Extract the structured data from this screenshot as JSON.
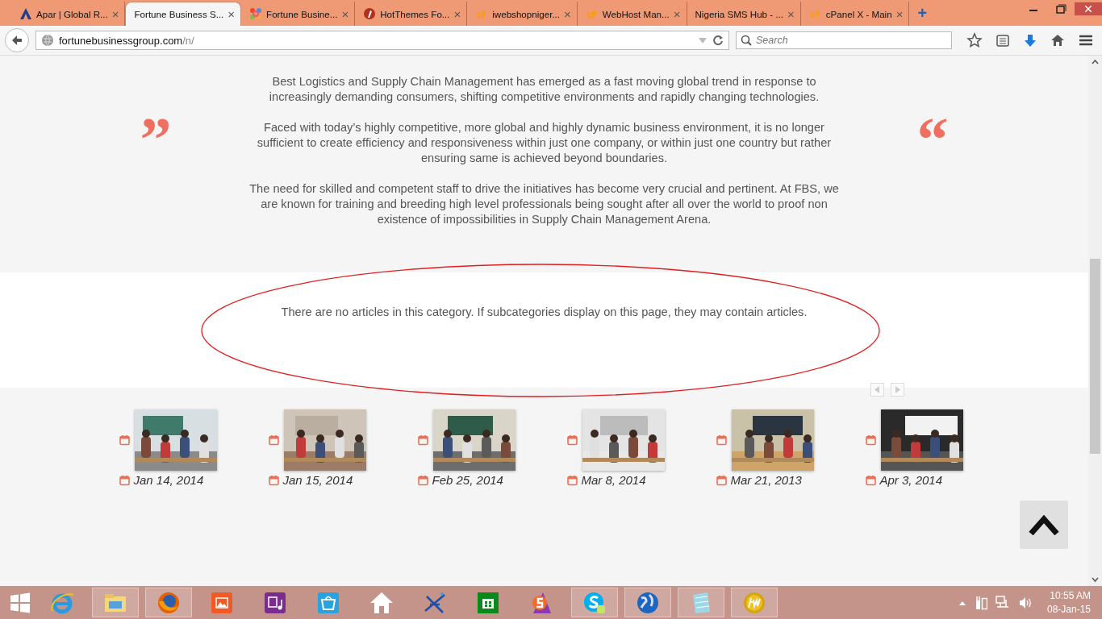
{
  "browser": {
    "tabs": [
      {
        "title": "Apar | Global R...",
        "selected": false
      },
      {
        "title": "Fortune Business S...",
        "selected": true
      },
      {
        "title": "Fortune Busine...",
        "selected": false
      },
      {
        "title": "HotThemes Fo...",
        "selected": false
      },
      {
        "title": "iwebshopniger...",
        "selected": false
      },
      {
        "title": "WebHost Man...",
        "selected": false
      },
      {
        "title": "Nigeria SMS Hub - ...",
        "selected": false
      },
      {
        "title": "cPanel X - Main",
        "selected": false
      }
    ],
    "close_glyph": "×",
    "new_tab": "+",
    "address": {
      "host": "fortunebusinessgroup.com",
      "path": "/n/"
    },
    "search": {
      "placeholder": "Search"
    }
  },
  "page": {
    "quote_open": "”",
    "quote_close": "“",
    "paragraphs": [
      "Best Logistics and Supply Chain Management has emerged as a fast moving global trend in response to increasingly demanding consumers, shifting competitive environments and rapidly changing technologies.",
      "Faced with today’s highly competitive, more global and highly dynamic business environment, it is no longer sufficient to create efficiency and responsiveness within just one company, or within just one country but rather ensuring same is achieved beyond boundaries.",
      "The need for skilled and competent staff to drive the initiatives has become very crucial and pertinent. At FBS, we are known for training and breeding high level professionals being sought after all over the world to proof non existence of impossibilities in Supply Chain Management Arena."
    ],
    "notice": "There are no articles in this category. If subcategories display on this page, they may contain articles.",
    "gallery": [
      {
        "date": "Jan 14, 2014",
        "kind": "picture"
      },
      {
        "date": "Jan 15, 2014",
        "kind": "picture"
      },
      {
        "date": "Feb 25, 2014",
        "kind": "picture"
      },
      {
        "date": "Mar 8, 2014",
        "kind": "picture"
      },
      {
        "date": "Mar 21, 2013",
        "kind": "picture"
      },
      {
        "date": "Apr 3, 2014",
        "kind": "picture"
      }
    ]
  },
  "taskbar": {
    "apps": [
      {
        "open": false
      },
      {
        "open": true
      },
      {
        "open": true
      },
      {
        "open": false
      },
      {
        "open": false
      },
      {
        "open": false
      },
      {
        "open": false
      },
      {
        "open": false
      },
      {
        "open": false
      },
      {
        "open": false
      },
      {
        "open": true
      },
      {
        "open": true
      },
      {
        "open": true
      },
      {
        "open": true
      }
    ],
    "time": "10:55 AM",
    "date": "08-Jan-15"
  }
}
